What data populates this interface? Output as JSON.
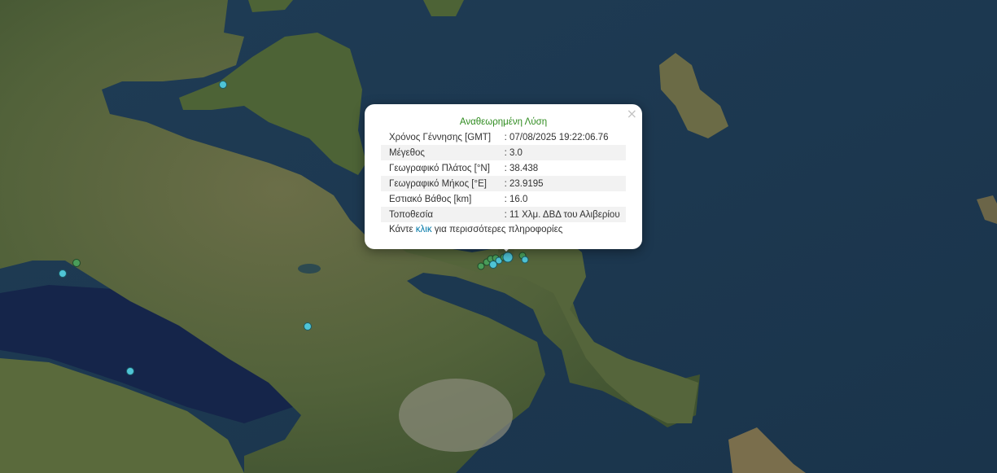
{
  "popup": {
    "title": "Αναθεωρημένη Λύση",
    "close": "×",
    "rows": [
      {
        "label": "Χρόνος Γέννησης [GMT]",
        "value": ": 07/08/2025 19:22:06.76"
      },
      {
        "label": "Μέγεθος",
        "value": ": 3.0"
      },
      {
        "label": "Γεωγραφικό Πλάτος [°N]",
        "value": ": 38.438"
      },
      {
        "label": "Γεωγραφικό Μήκος [°E]",
        "value": ": 23.9195"
      },
      {
        "label": "Εστιακό Βάθος [km]",
        "value": ": 16.0"
      },
      {
        "label": "Τοποθεσία",
        "value": ": 11 Χλμ. ΔΒΔ του Αλιβερίου"
      }
    ],
    "more_prefix": "Κάντε ",
    "more_link": "κλικ",
    "more_suffix": " για περισσότερες πληροφορίες"
  },
  "map": {
    "sea_color": "#1d3a52",
    "land_color": "#5b6a3e",
    "cyan_marker_color": "#4fc4d6",
    "green_marker_color": "#4a9d5a"
  }
}
